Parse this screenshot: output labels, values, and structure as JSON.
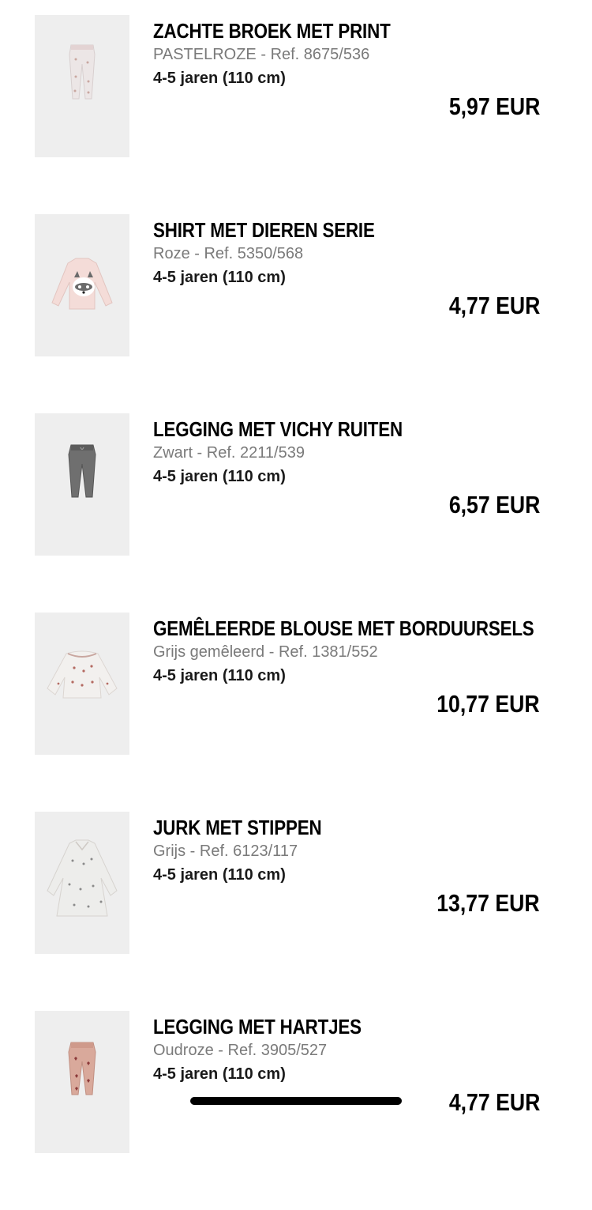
{
  "cart": {
    "items": [
      {
        "name": "ZACHTE BROEK MET PRINT",
        "color": "PASTELROZE",
        "ref": "Ref. 8675/536",
        "size": "4-5 jaren (110 cm)",
        "price": "5,97 EUR",
        "image_icon": "pants-icon",
        "image_tint": "#ece6e6"
      },
      {
        "name": "SHIRT MET DIEREN SERIE",
        "color": "Roze",
        "ref": "Ref. 5350/568",
        "size": "4-5 jaren (110 cm)",
        "price": "4,77 EUR",
        "image_icon": "shirt-icon",
        "image_tint": "#f4dcd8"
      },
      {
        "name": "LEGGING MET VICHY RUITEN",
        "color": "Zwart",
        "ref": "Ref. 2211/539",
        "size": "4-5 jaren (110 cm)",
        "price": "6,57 EUR",
        "image_icon": "pants-icon",
        "image_tint": "#6f6f6f"
      },
      {
        "name": "GEMÊLEERDE BLOUSE MET BORDUURSELS",
        "color": "Grijs gemêleerd",
        "ref": "Ref. 1381/552",
        "size": "4-5 jaren (110 cm)",
        "price": "10,77 EUR",
        "image_icon": "blouse-icon",
        "image_tint": "#f2f0ee"
      },
      {
        "name": "JURK MET STIPPEN",
        "color": "Grijs",
        "ref": "Ref. 6123/117",
        "size": "4-5 jaren (110 cm)",
        "price": "13,77 EUR",
        "image_icon": "dress-icon",
        "image_tint": "#ededeb"
      },
      {
        "name": "LEGGING MET HARTJES",
        "color": "Oudroze",
        "ref": "Ref. 3905/527",
        "size": "4-5 jaren (110 cm)",
        "price": "4,77 EUR",
        "image_icon": "pants-icon",
        "image_tint": "#d9a99b"
      }
    ]
  }
}
